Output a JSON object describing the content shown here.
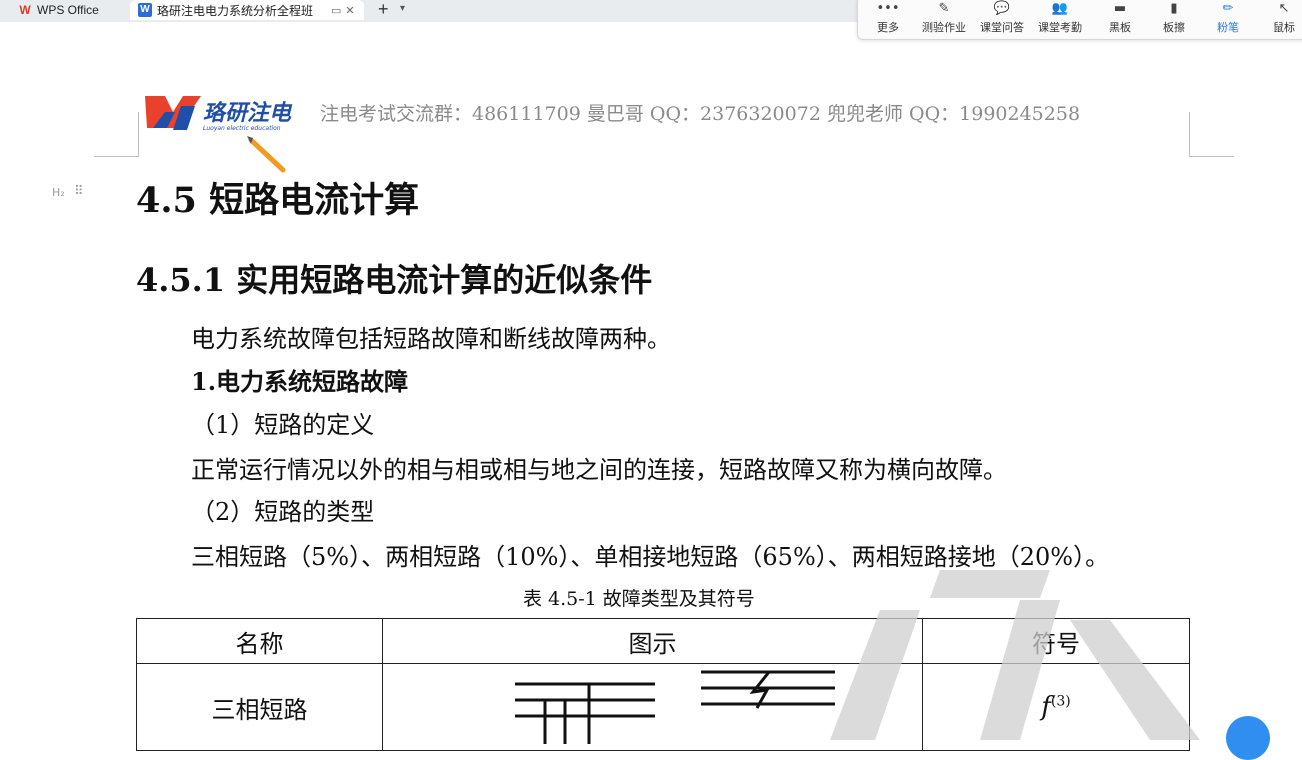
{
  "tabs": {
    "wps_label": "WPS Office",
    "doc_label": "珞研注电电力系统分析全程班"
  },
  "toolbar": {
    "items": [
      {
        "label": "更多",
        "icon": "more-icon"
      },
      {
        "label": "测验作业",
        "icon": "quiz-icon"
      },
      {
        "label": "课堂问答",
        "icon": "qa-icon"
      },
      {
        "label": "课堂考勤",
        "icon": "attendance-icon"
      },
      {
        "label": "黑板",
        "icon": "blackboard-icon"
      },
      {
        "label": "板擦",
        "icon": "eraser-icon"
      },
      {
        "label": "粉笔",
        "icon": "chalk-icon",
        "active": true
      },
      {
        "label": "鼠标",
        "icon": "mouse-icon"
      }
    ],
    "active_color": "#2a7de1"
  },
  "header": {
    "logo_text": "珞研注电",
    "logo_subtext": "Luoyan electric education",
    "contact_line": "注电考试交流群：486111709    曼巴哥 QQ：2376320072   兜兜老师 QQ：1990245258"
  },
  "doc": {
    "heading_marker": "H₂",
    "h1": "4.5  短路电流计算",
    "h2": "4.5.1  实用短路电流计算的近似条件",
    "p1": "电力系统故障包括短路故障和断线故障两种。",
    "p2": "1.电力系统短路故障",
    "p3": "（1）短路的定义",
    "p4": "正常运行情况以外的相与相或相与地之间的连接，短路故障又称为横向故障。",
    "p5": "（2）短路的类型",
    "p6": "三相短路（5%）、两相短路（10%）、单相接地短路（65%）、两相短路接地（20%）。",
    "table_caption": "表 4.5-1    故障类型及其符号",
    "table": {
      "headers": [
        "名称",
        "图示",
        "符号"
      ],
      "rows": [
        {
          "name": "三相短路",
          "symbol_base": "f",
          "symbol_sup": "(3)"
        }
      ]
    }
  }
}
